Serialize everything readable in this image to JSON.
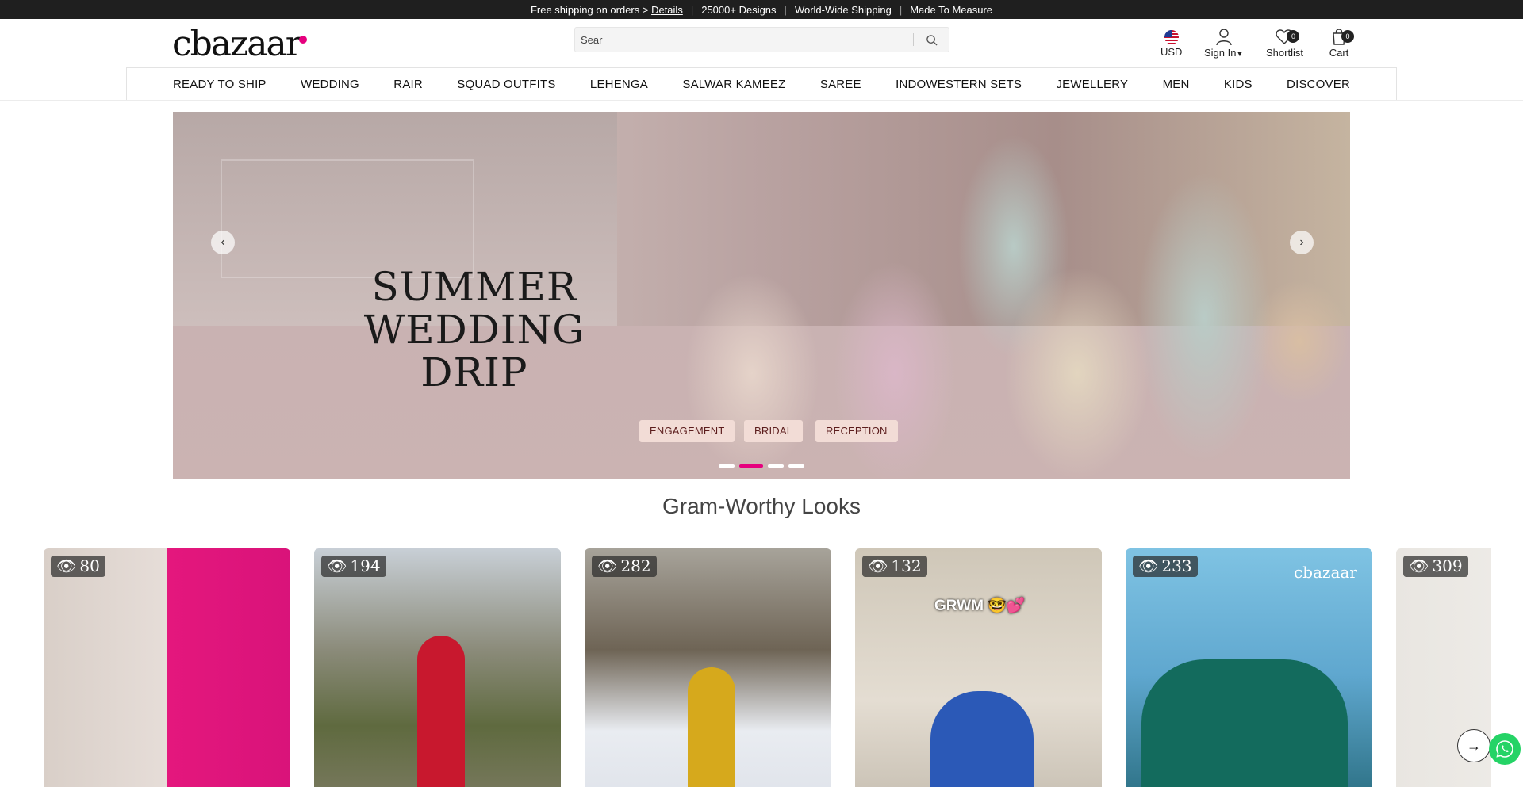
{
  "announcement": {
    "shipping_prefix": "Free shipping on orders > ",
    "details_link": "Details",
    "designs": "25000+ Designs",
    "worldwide": "World-Wide Shipping",
    "measure": "Made To Measure",
    "separator": "|"
  },
  "header": {
    "logo_text": "cbazaar",
    "search_value": "Sear",
    "currency": "USD",
    "sign_in": "Sign In",
    "shortlist_label": "Shortlist",
    "shortlist_count": "0",
    "cart_label": "Cart",
    "cart_count": "0"
  },
  "nav": {
    "items": [
      "READY TO SHIP",
      "WEDDING",
      "RAIR",
      "SQUAD OUTFITS",
      "LEHENGA",
      "SALWAR KAMEEZ",
      "SAREE",
      "INDOWESTERN SETS",
      "JEWELLERY",
      "MEN",
      "KIDS",
      "DISCOVER"
    ]
  },
  "hero": {
    "headline_line1": "SUMMER",
    "headline_line2": "WEDDING DRIP",
    "chips": [
      "ENGAGEMENT",
      "BRIDAL",
      "RECEPTION"
    ],
    "slide_count": 4,
    "active_slide": 2
  },
  "gram_section": {
    "title": "Gram-Worthy Looks",
    "reels": [
      {
        "views": "80"
      },
      {
        "views": "194"
      },
      {
        "views": "282"
      },
      {
        "views": "132",
        "caption": "GRWM 🤓💕"
      },
      {
        "views": "233",
        "caption": "cbazaar"
      },
      {
        "views": "309"
      }
    ]
  },
  "colors": {
    "accent": "#e6007e",
    "topbar_bg": "#1f1f1f",
    "chip_bg": "#f2dcd6",
    "chip_text": "#5b1c1c",
    "whatsapp": "#25d366"
  }
}
